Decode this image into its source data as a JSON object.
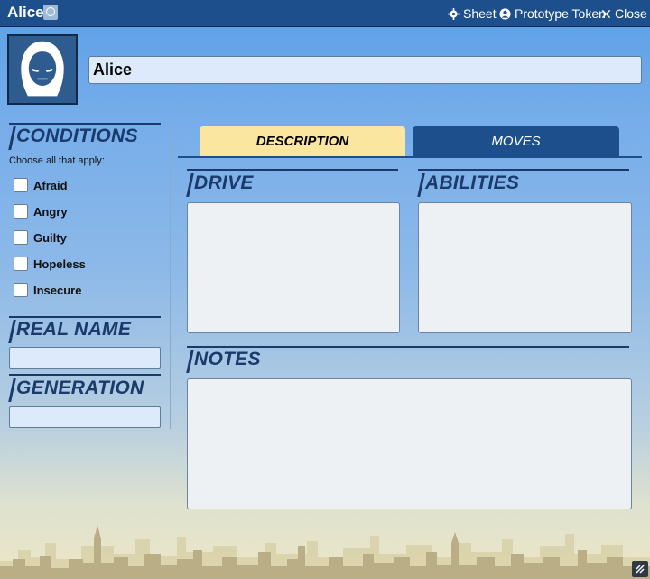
{
  "header": {
    "title": "Alice",
    "sheet_label": "Sheet",
    "prototype_label": "Prototype Token",
    "close_label": "Close"
  },
  "profile": {
    "name": "Alice"
  },
  "conditions": {
    "heading": "CONDITIONS",
    "hint": "Choose all that apply:",
    "items": [
      {
        "label": "Afraid",
        "checked": false
      },
      {
        "label": "Angry",
        "checked": false
      },
      {
        "label": "Guilty",
        "checked": false
      },
      {
        "label": "Hopeless",
        "checked": false
      },
      {
        "label": "Insecure",
        "checked": false
      }
    ]
  },
  "real_name": {
    "heading": "REAL NAME",
    "value": ""
  },
  "generation": {
    "heading": "GENERATION",
    "value": ""
  },
  "tabs": [
    {
      "label": "DESCRIPTION",
      "active": true
    },
    {
      "label": "MOVES",
      "active": false
    }
  ],
  "description": {
    "drive_heading": "DRIVE",
    "abilities_heading": "ABILITIES",
    "notes_heading": "NOTES",
    "drive_value": "",
    "abilities_value": "",
    "notes_value": ""
  },
  "colors": {
    "header_bg": "#1d4f8c",
    "heading_text": "#1a3a6b",
    "active_tab": "#fbe6a0",
    "inactive_tab": "#1d4f8c"
  },
  "icons": [
    "id-badge-icon",
    "gear-icon",
    "user-circle-icon",
    "close-icon",
    "hooded-figure-icon",
    "resize-icon"
  ]
}
